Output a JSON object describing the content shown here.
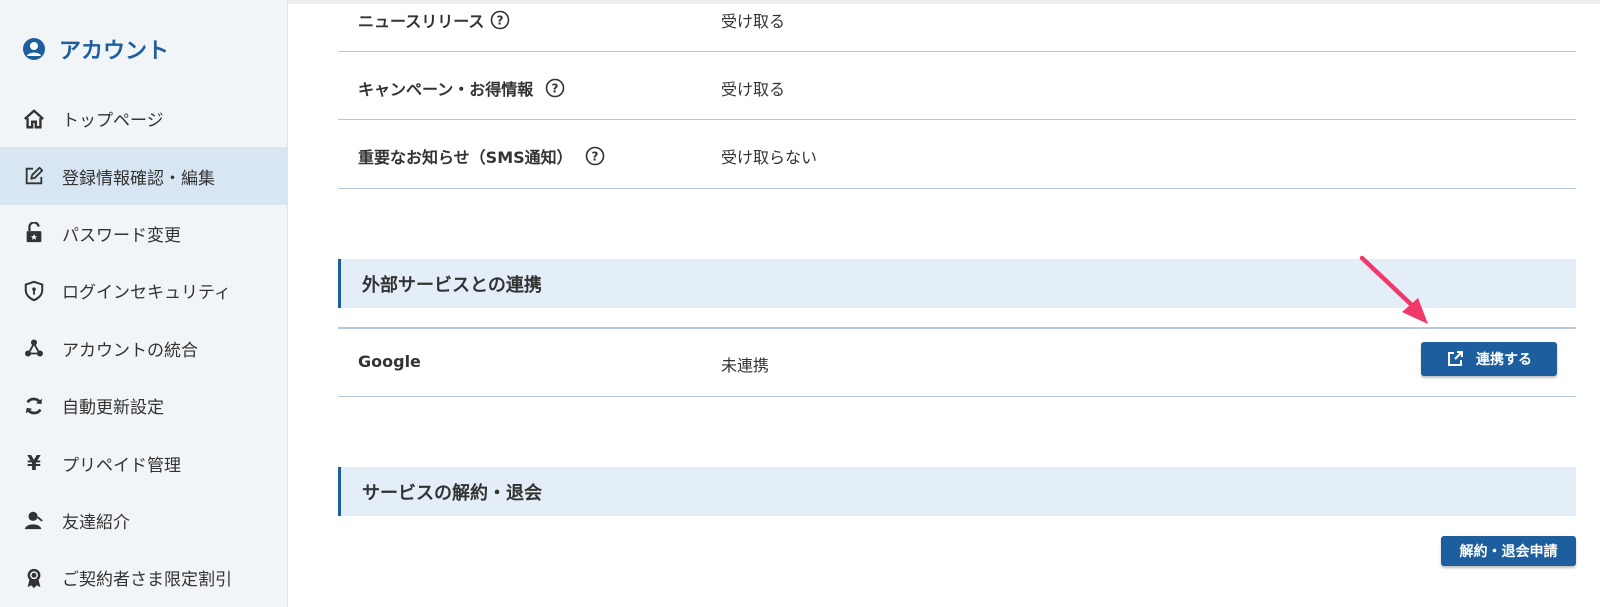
{
  "sidebar": {
    "title": "アカウント",
    "items": [
      {
        "label": "トップページ",
        "icon": "home-icon"
      },
      {
        "label": "登録情報確認・編集",
        "icon": "edit-icon",
        "active": true
      },
      {
        "label": "パスワード変更",
        "icon": "lock-icon"
      },
      {
        "label": "ログインセキュリティ",
        "icon": "shield-icon"
      },
      {
        "label": "アカウントの統合",
        "icon": "merge-icon"
      },
      {
        "label": "自動更新設定",
        "icon": "refresh-icon"
      },
      {
        "label": "プリペイド管理",
        "icon": "yen-icon",
        "glyph": "¥"
      },
      {
        "label": "友達紹介",
        "icon": "user-icon"
      },
      {
        "label": "ご契約者さま限定割引",
        "icon": "badge-icon"
      }
    ]
  },
  "settings": {
    "rows": [
      {
        "label": "ニュースリリース",
        "value": "受け取る"
      },
      {
        "label": "キャンペーン・お得情報",
        "value": "受け取る"
      },
      {
        "label": "重要なお知らせ（SMS通知）",
        "value": "受け取らない"
      }
    ]
  },
  "external": {
    "header": "外部サービスとの連携",
    "service": "Google",
    "status": "未連携",
    "button_label": "連携する"
  },
  "cancellation": {
    "header": "サービスの解約・退会",
    "button_label": "解約・退会申請"
  },
  "colors": {
    "accent": "#1d5e9e",
    "sidebar_bg": "#f2f5f8",
    "active_bg": "#d8e6f3",
    "section_bg": "#e4eef8",
    "divider": "#b7c8d9",
    "arrow": "#f0386b"
  }
}
